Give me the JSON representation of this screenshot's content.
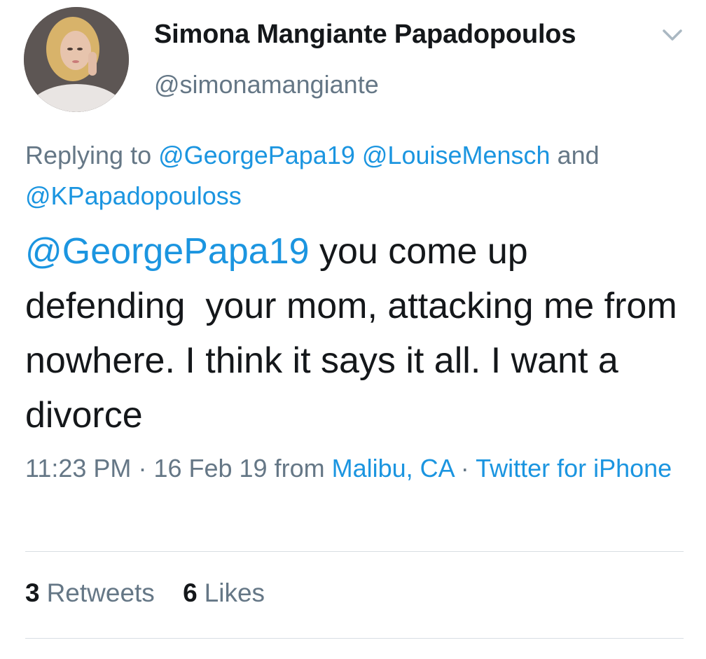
{
  "author": {
    "display_name": "Simona Mangiante Papadopoulos",
    "handle": "@simonamangiante"
  },
  "reply_context": {
    "prefix": "Replying to",
    "mentions": [
      "@GeorgePapa19",
      "@LouiseMensch"
    ],
    "conjunction": "and",
    "last_mention": "@KPapadopouloss"
  },
  "tweet": {
    "mention": "@GeorgePapa19",
    "text": " you come up defending  your mom, attacking me from nowhere. I think it says it all. I want a divorce"
  },
  "meta": {
    "time": "11:23 PM",
    "separator": "·",
    "date": "16 Feb 19",
    "from_label": "from",
    "location": "Malibu, CA",
    "source": "Twitter for iPhone"
  },
  "stats": {
    "retweets_count": "3",
    "retweets_label": "Retweets",
    "likes_count": "6",
    "likes_label": "Likes"
  },
  "colors": {
    "link": "#1b95e0",
    "secondary_text": "#657786",
    "primary_text": "#14171a",
    "divider": "#d8dee3"
  },
  "icons": {
    "caret": "chevron-down-icon",
    "avatar": "profile-photo"
  }
}
